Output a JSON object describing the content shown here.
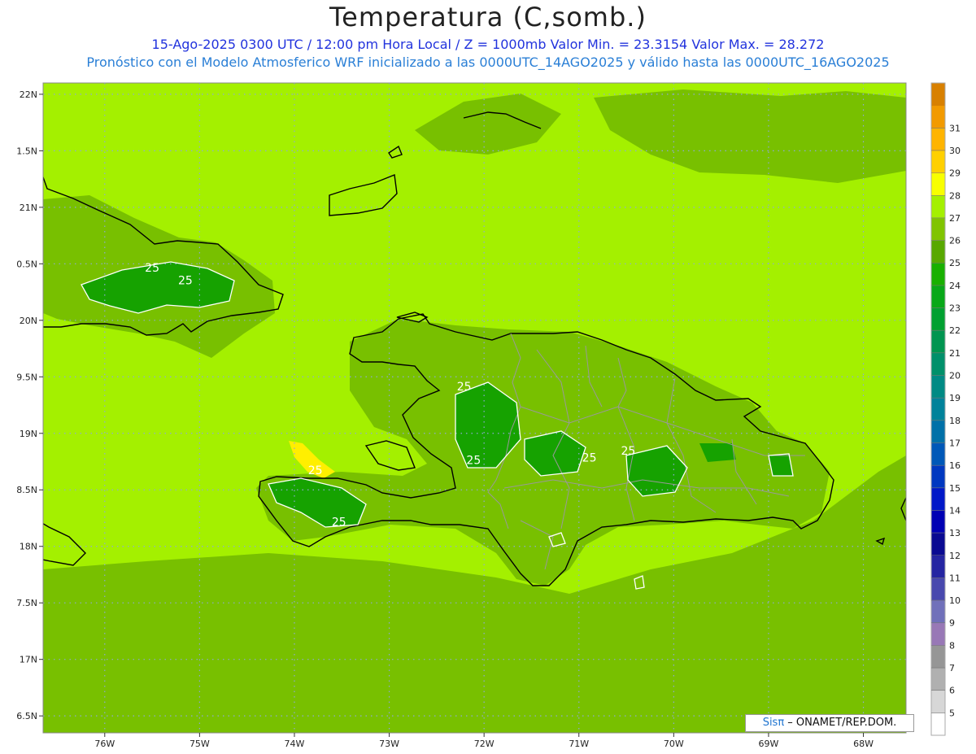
{
  "header": {
    "title": "Temperatura (C,somb.)",
    "subtitle_line1": "15-Ago-2025 0300 UTC / 12:00 pm Hora Local / Z = 1000mb   Valor Min. = 23.3154  Valor Max. = 28.272",
    "subtitle_line2": "Pronóstico con el Modelo Atmosferico WRF inicializado a las 0000UTC_14AGO2025 y válido hasta las  0000UTC_16AGO2025"
  },
  "map": {
    "lon_range": [
      -76.65,
      -67.55
    ],
    "lat_range": [
      16.35,
      22.1
    ],
    "lon_ticks": [
      {
        "value": -76,
        "label": "76W"
      },
      {
        "value": -75,
        "label": "75W"
      },
      {
        "value": -74,
        "label": "74W"
      },
      {
        "value": -73,
        "label": "73W"
      },
      {
        "value": -72,
        "label": "72W"
      },
      {
        "value": -71,
        "label": "71W"
      },
      {
        "value": -70,
        "label": "70W"
      },
      {
        "value": -69,
        "label": "69W"
      },
      {
        "value": -68,
        "label": "68W"
      }
    ],
    "lat_ticks": [
      {
        "value": 22,
        "label": "22N"
      },
      {
        "value": 21.5,
        "label": "1.5N"
      },
      {
        "value": 21,
        "label": "21N"
      },
      {
        "value": 20.5,
        "label": "0.5N"
      },
      {
        "value": 20,
        "label": "20N"
      },
      {
        "value": 19.5,
        "label": "9.5N"
      },
      {
        "value": 19,
        "label": "19N"
      },
      {
        "value": 18.5,
        "label": "8.5N"
      },
      {
        "value": 18,
        "label": "18N"
      },
      {
        "value": 17.5,
        "label": "7.5N"
      },
      {
        "value": 17,
        "label": "17N"
      },
      {
        "value": 16.5,
        "label": "6.5N"
      }
    ],
    "contour_labels": [
      {
        "text": "25",
        "lon": -75.5,
        "lat": 20.43
      },
      {
        "text": "25",
        "lon": -75.15,
        "lat": 20.32
      },
      {
        "text": "25",
        "lon": -72.21,
        "lat": 19.38
      },
      {
        "text": "25",
        "lon": -72.11,
        "lat": 18.73
      },
      {
        "text": "25",
        "lon": -73.78,
        "lat": 18.64
      },
      {
        "text": "25",
        "lon": -73.53,
        "lat": 18.18
      },
      {
        "text": "25",
        "lon": -70.89,
        "lat": 18.75
      },
      {
        "text": "25",
        "lon": -70.48,
        "lat": 18.81
      }
    ],
    "colors": {
      "ocean": "#a4f000",
      "land": "#78c000",
      "warm": "#ffef00",
      "cool": "#16a200",
      "grid": "#8fa8d8",
      "coast": "#000000",
      "border": "#999999",
      "contour": "#ffffff"
    }
  },
  "colorbar": {
    "colors": [
      "#ffffff",
      "#d7d7d7",
      "#b0b0b0",
      "#969696",
      "#9878b6",
      "#7070ba",
      "#4848ae",
      "#2525a2",
      "#0a0a92",
      "#0000b4",
      "#0018c8",
      "#0038c0",
      "#0058b8",
      "#0070a8",
      "#00829a",
      "#008a84",
      "#00906a",
      "#009550",
      "#00a030",
      "#08a818",
      "#18b000",
      "#58a800",
      "#80c400",
      "#a4f000",
      "#f8ff00",
      "#ffd000",
      "#ffb400",
      "#f29a00",
      "#d88000"
    ],
    "labels": [
      "5",
      "6",
      "7",
      "8",
      "9",
      "10",
      "11",
      "12",
      "13",
      "14",
      "15",
      "16",
      "17",
      "18",
      "19",
      "20",
      "21",
      "22",
      "23",
      "24",
      "25",
      "26",
      "27",
      "28",
      "29",
      "30",
      "31"
    ]
  },
  "credit": {
    "brand": "Sisπ",
    "text": " – ONAMET/REP.DOM."
  }
}
